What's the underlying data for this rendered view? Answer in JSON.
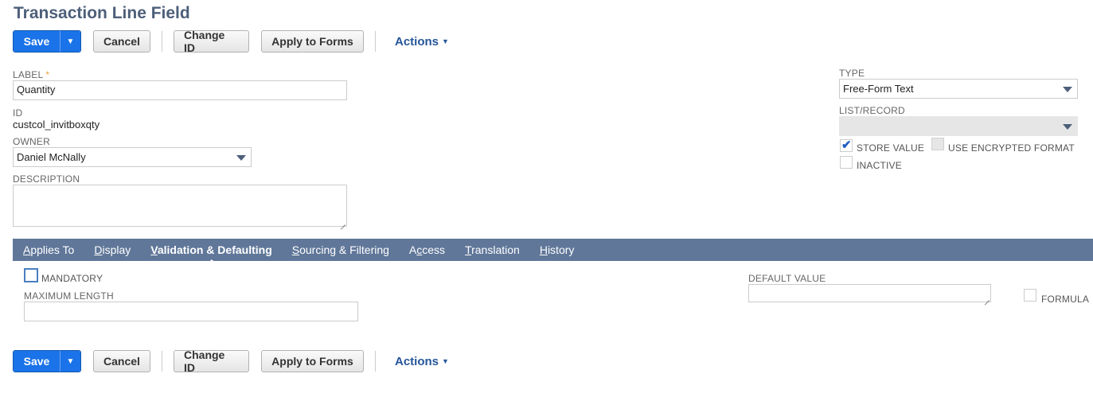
{
  "page": {
    "title": "Transaction Line Field"
  },
  "toolbar": {
    "save_label": "Save",
    "cancel_label": "Cancel",
    "change_id_label": "Change ID",
    "apply_to_forms_label": "Apply to Forms",
    "actions_label": "Actions"
  },
  "form": {
    "label": {
      "label": "LABEL",
      "required_marker": "*",
      "value": "Quantity"
    },
    "id": {
      "label": "ID",
      "value": "custcol_invitboxqty"
    },
    "owner": {
      "label": "OWNER",
      "value": "Daniel McNally"
    },
    "description": {
      "label": "DESCRIPTION",
      "value": ""
    },
    "type": {
      "label": "TYPE",
      "value": "Free-Form Text"
    },
    "list_record": {
      "label": "LIST/RECORD",
      "value": ""
    },
    "store_value": {
      "label": "STORE VALUE",
      "checked": true
    },
    "use_encrypted_format": {
      "label": "USE ENCRYPTED FORMAT",
      "checked": false
    },
    "inactive": {
      "label": "INACTIVE",
      "checked": false
    }
  },
  "tabs": [
    {
      "label": "Applies To",
      "ul": "A",
      "rest": "pplies To",
      "active": false
    },
    {
      "label": "Display",
      "ul": "D",
      "rest": "isplay",
      "active": false
    },
    {
      "label": "Validation & Defaulting",
      "ul": "V",
      "rest": "alidation & Defaulting",
      "active": true
    },
    {
      "label": "Sourcing & Filtering",
      "ul": "S",
      "rest": "ourcing & Filtering",
      "active": false
    },
    {
      "label": "Access",
      "pre": "A",
      "ul": "c",
      "rest": "cess",
      "active": false
    },
    {
      "label": "Translation",
      "ul": "T",
      "rest": "ranslation",
      "active": false
    },
    {
      "label": "History",
      "ul": "H",
      "rest": "istory",
      "active": false
    }
  ],
  "validation": {
    "mandatory": {
      "label": "MANDATORY",
      "checked": false
    },
    "maximum_length": {
      "label": "MAXIMUM LENGTH",
      "value": ""
    },
    "default_value": {
      "label": "DEFAULT VALUE",
      "value": ""
    },
    "formula": {
      "label": "FORMULA",
      "checked": false
    }
  },
  "colors": {
    "title": "#4d5f79",
    "primary_button": "#1a73e8",
    "tab_bar": "#607799",
    "link": "#255599"
  }
}
